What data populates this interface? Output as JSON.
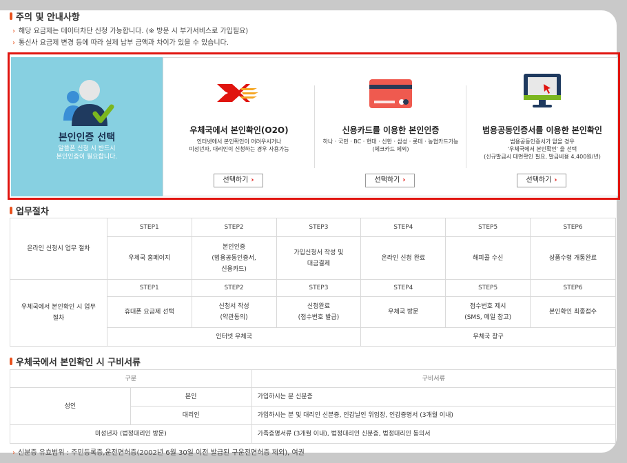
{
  "notice": {
    "title": "주의 및 안내사항",
    "line1": "해당 요금제는 데이터차단 신청 가능합니다. (※ 방문 시 부가서비스로 가입필요)",
    "line2": "통신사 요금제 변경 등에 따라 실제 납부 금액과 차이가 있을 수 있습니다."
  },
  "cert": {
    "left_title": "본인인증 선택",
    "left_sub1": "알뜰폰 신청 시 반드시",
    "left_sub2": "본인인증이 필요합니다.",
    "options": [
      {
        "title": "우체국에서 본인확인(O2O)",
        "desc1": "인터넷에서 본인확인이 어려우시거나",
        "desc2": "미성년자, 대리인이 신청하는 경우 사용가능",
        "desc3": "",
        "button": "선택하기"
      },
      {
        "title": "신용카드를 이용한 본인인증",
        "desc1": "하나 · 국민 · BC · 현대 · 신한 · 삼성 · 롯데 · 농협카드가능",
        "desc2": "(체크카드 제외)",
        "desc3": "",
        "button": "선택하기"
      },
      {
        "title": "범용공동인증서를 이용한 본인확인",
        "desc1": "범용공동인증서가 없을 경우",
        "desc2": "'우체국에서 본인확인' 을 선택",
        "desc3": "(신규발급시 대면확인 필요, 발급비용 4,400원/년)",
        "button": "선택하기"
      }
    ]
  },
  "process": {
    "title": "업무절차",
    "online_label": "온라인 신청시 업무 절차",
    "online_steps": [
      "STEP1",
      "STEP2",
      "STEP3",
      "STEP4",
      "STEP5",
      "STEP6"
    ],
    "online_desc": [
      [
        "우체국 홈페이지"
      ],
      [
        "본인인증",
        "(범용공동인증서,",
        "신용카드)"
      ],
      [
        "가입신청서 작성 및",
        "대금결제"
      ],
      [
        "온라인 신청 완료"
      ],
      [
        "해피콜 수신"
      ],
      [
        "상품수령 개통완료"
      ]
    ],
    "post_label1": "우체국에서 본인확인 시 업무",
    "post_label2": "절차",
    "post_steps": [
      "STEP1",
      "STEP2",
      "STEP3",
      "STEP4",
      "STEP5",
      "STEP6"
    ],
    "post_desc": [
      [
        "휴대폰 요금제 선택"
      ],
      [
        "신청서 작성",
        "(약관동의)"
      ],
      [
        "신청완료",
        "(접수번호 발급)"
      ],
      [
        "우체국 방문"
      ],
      [
        "접수번호 제시",
        "(SMS, 메일 참고)"
      ],
      [
        "본인확인 최종접수"
      ]
    ],
    "post_group1": "인터넷 우체국",
    "post_group2": "우체국 창구"
  },
  "docs": {
    "title": "우체국에서 본인확인 시 구비서류",
    "col1": "구분",
    "col2": "구비서류",
    "adult": "성인",
    "self": "본인",
    "self_docs": "가입하시는 분 신분증",
    "agent": "대리인",
    "agent_docs": "가입하시는 분 및 대리인 신분증, 인감날인 위임장, 인감증명서 (3개월 이내)",
    "minor": "미성년자 (법정대리인 방문)",
    "minor_docs": "가족증명서류 (3개월 이내), 법정대리인 신분증, 법정대리인 동의서"
  },
  "footnote": "신분증 유효범위 : 주민등록증,운전면허증(2002년 6월 30일 이전 발급된 구운전면허증 제외), 여권",
  "colors": {
    "accent": "#e8521e",
    "highlight_border": "#e0140f",
    "left_panel": "#87d0e1"
  }
}
